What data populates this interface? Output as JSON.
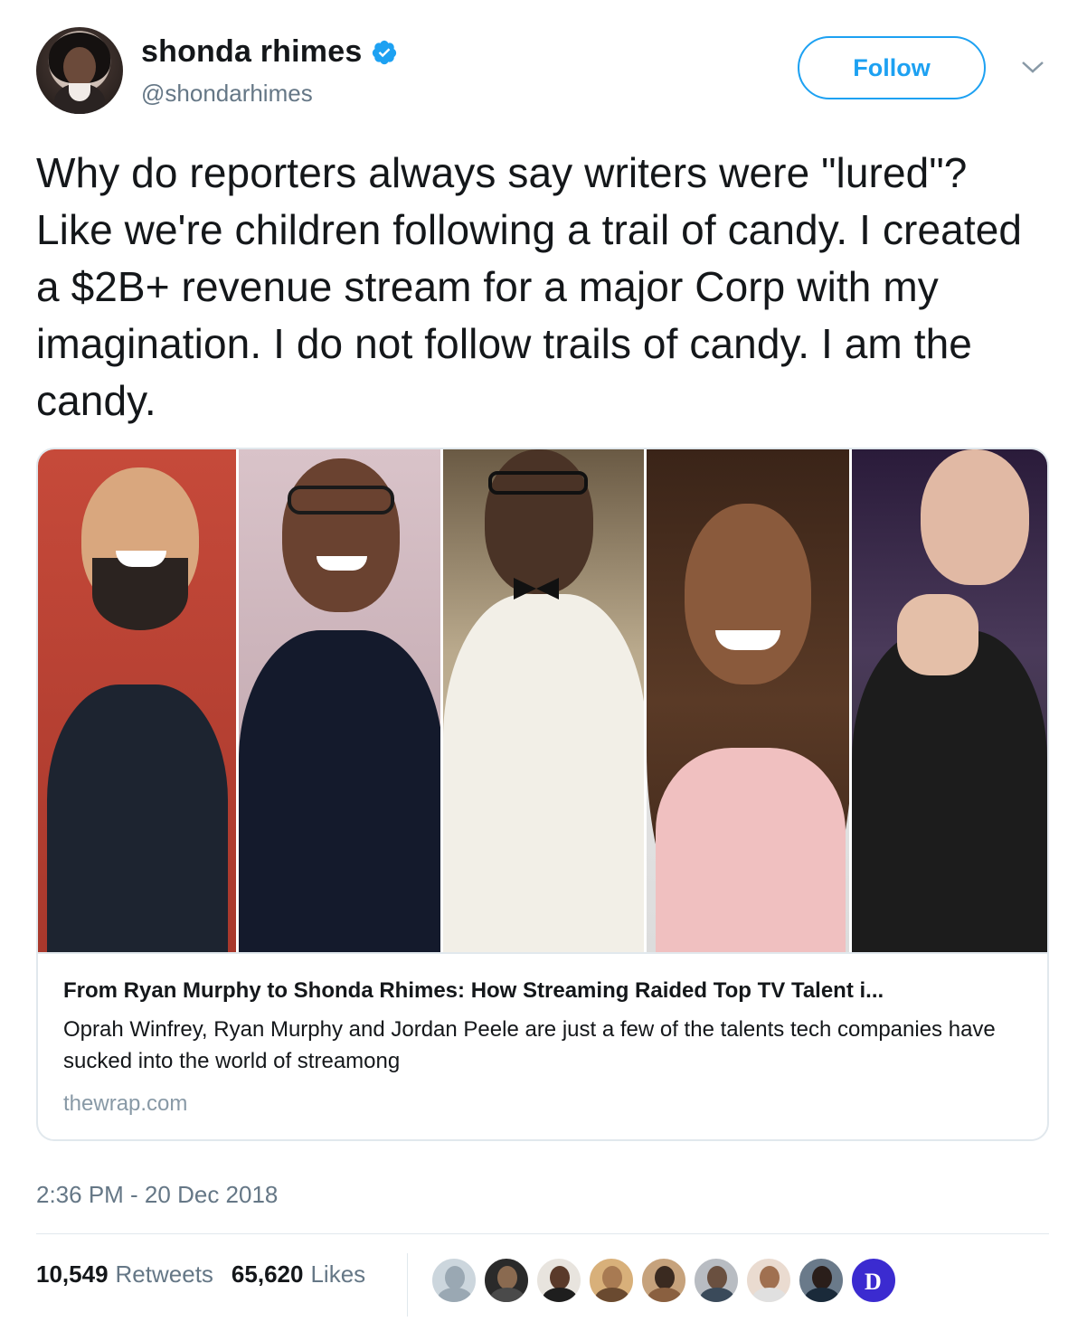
{
  "user": {
    "display_name": "shonda rhimes",
    "handle": "@shondarhimes",
    "verified": true
  },
  "actions": {
    "follow_label": "Follow"
  },
  "tweet": {
    "text": "Why do reporters always say writers were \"lured\"? Like we're children following a trail of candy. I created a $2B+ revenue stream for a major Corp with my imagination.  I do not follow trails of candy.  I am the candy.",
    "timestamp": "2:36 PM - 20 Dec 2018"
  },
  "card": {
    "title": "From Ryan Murphy to Shonda Rhimes: How Streaming Raided Top TV Talent i...",
    "description": "Oprah Winfrey, Ryan Murphy and Jordan Peele are just a few of the talents tech companies have sucked into the world of streamong",
    "domain": "thewrap.com"
  },
  "stats": {
    "retweets_count": "10,549",
    "retweets_label": "Retweets",
    "likes_count": "65,620",
    "likes_label": "Likes"
  },
  "colors": {
    "accent": "#1da1f2",
    "secondary_text": "#657786",
    "border": "#e1e8ed"
  },
  "icons": [
    "verified-badge-icon",
    "chevron-down-icon"
  ]
}
